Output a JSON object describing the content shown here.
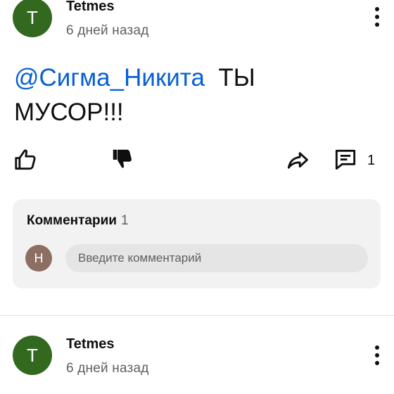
{
  "post1": {
    "avatar_letter": "T",
    "author": "Tetmes",
    "time": "6 дней назад",
    "mention": "@Сигма_Никита",
    "text": "ТЫ МУСОР!!!",
    "comment_count": "1",
    "icons": [
      "like-icon",
      "dislike-icon",
      "share-icon",
      "comment-icon",
      "more-icon"
    ]
  },
  "comments_section": {
    "title": "Комментарии",
    "count": "1",
    "user_avatar_letter": "Н",
    "input_placeholder": "Введите комментарий"
  },
  "post2": {
    "avatar_letter": "T",
    "author": "Tetmes",
    "time": "6 дней назад"
  },
  "colors": {
    "avatar_bg": "#33691e",
    "user_avatar_bg": "#8d6e63",
    "mention": "#065fd4",
    "comment_box_bg": "#f2f2f2"
  }
}
